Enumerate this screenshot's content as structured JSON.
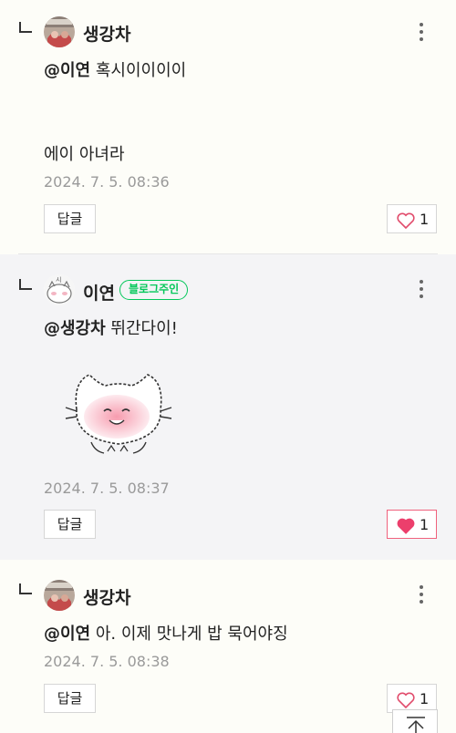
{
  "comments": [
    {
      "nickname": "생강차",
      "mention": "@이연",
      "text": "혹시이이이이",
      "text2": "에이 아녀라",
      "date": "2024. 7. 5. 08:36",
      "reply_label": "답글",
      "likes": "1",
      "liked": false
    },
    {
      "nickname": "이연",
      "badge": "블로그주인",
      "mention": "@생강차",
      "text": "뛰간다이!",
      "sticker": "cat-sticker",
      "date": "2024. 7. 5. 08:37",
      "reply_label": "답글",
      "likes": "1",
      "liked": true
    },
    {
      "nickname": "생강차",
      "mention": "@이연",
      "text": "아. 이제 맛나게 밥 묵어야징",
      "date": "2024. 7. 5. 08:38",
      "reply_label": "답글",
      "likes": "1",
      "liked": false
    }
  ],
  "colors": {
    "accent_green": "#03c75a",
    "like_pink": "#f0627d",
    "date_gray": "#9a9a9a"
  },
  "icons": [
    "reply-indent-icon",
    "more-vertical-icon",
    "heart-icon",
    "heart-filled-icon",
    "scroll-top-icon"
  ]
}
